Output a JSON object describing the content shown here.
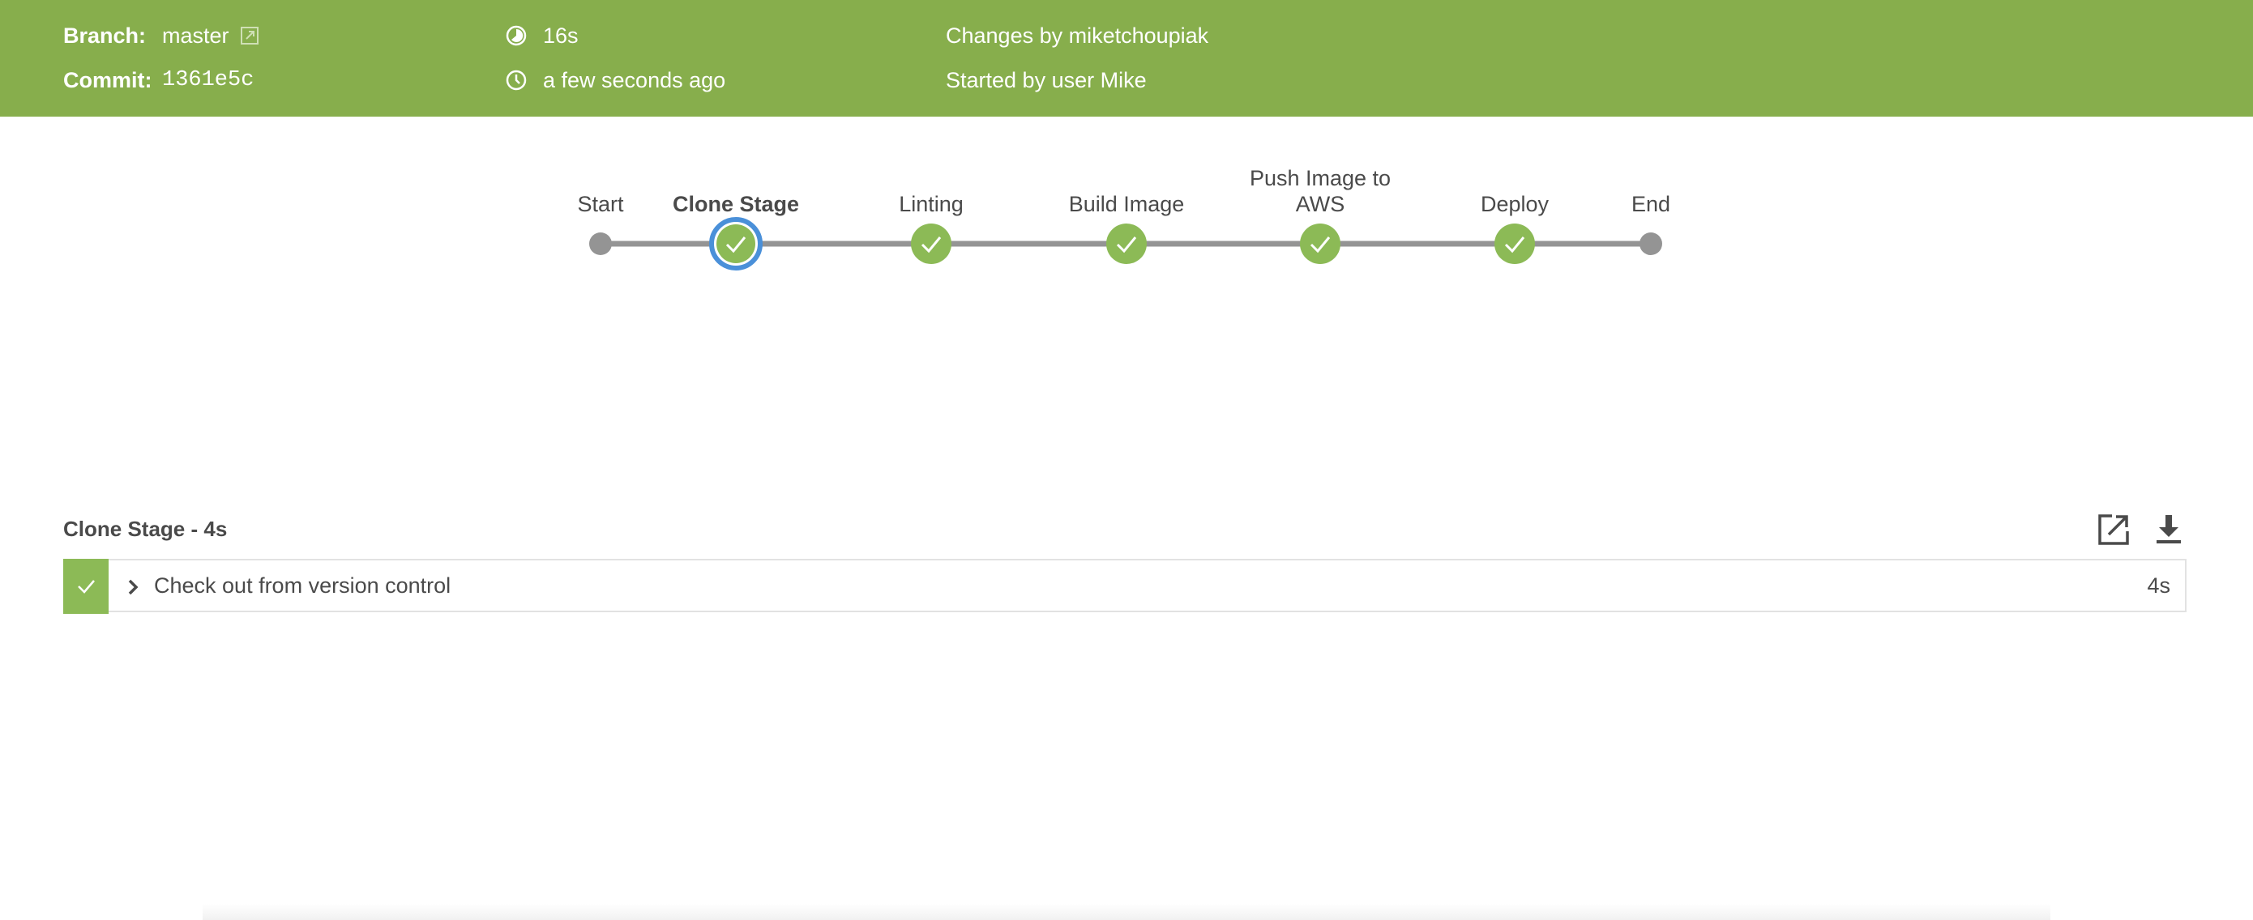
{
  "header": {
    "branch_label": "Branch:",
    "branch_value": "master",
    "commit_label": "Commit:",
    "commit_value": "1361e5c",
    "duration": "16s",
    "started_ago": "a few seconds ago",
    "changes": "Changes by miketchoupiak",
    "started_by": "Started by user Mike",
    "background_color": "#87ae4c"
  },
  "pipeline": {
    "stages": [
      {
        "label": "Start",
        "type": "start"
      },
      {
        "label": "Clone Stage",
        "type": "stage",
        "status": "success",
        "selected": true
      },
      {
        "label": "Linting",
        "type": "stage",
        "status": "success"
      },
      {
        "label": "Build Image",
        "type": "stage",
        "status": "success"
      },
      {
        "label_line1": "Push Image to",
        "label_line2": "AWS",
        "type": "stage",
        "status": "success"
      },
      {
        "label": "Deploy",
        "type": "stage",
        "status": "success"
      },
      {
        "label": "End",
        "type": "end"
      }
    ],
    "success_color": "#8cba56",
    "selected_color": "#4a90d9"
  },
  "detail": {
    "title": "Clone Stage - 4s",
    "actions": [
      {
        "icon": "open-external-icon"
      },
      {
        "icon": "download-icon"
      }
    ],
    "steps": [
      {
        "name": "Check out from version control",
        "duration": "4s",
        "status": "success"
      }
    ]
  }
}
